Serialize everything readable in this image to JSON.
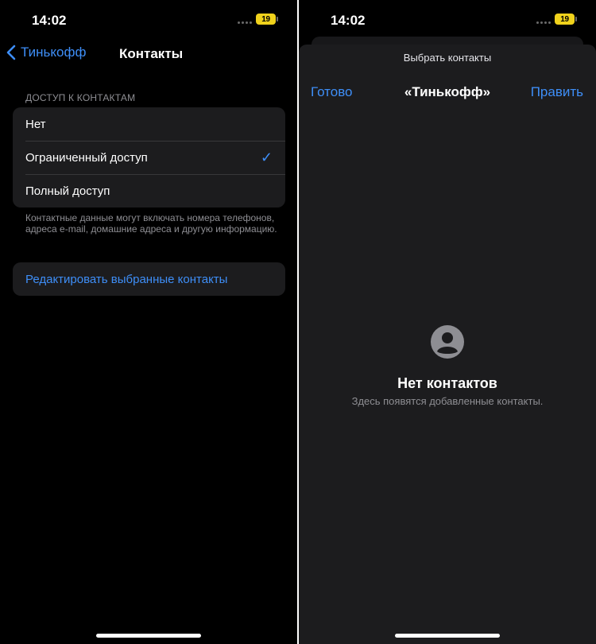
{
  "status_bar": {
    "time": "14:02",
    "battery": "19"
  },
  "left": {
    "nav": {
      "back_label": "Тинькофф",
      "title": "Контакты"
    },
    "section_header": "ДОСТУП К КОНТАКТАМ",
    "options": [
      {
        "label": "Нет",
        "selected": false
      },
      {
        "label": "Ограниченный доступ",
        "selected": true
      },
      {
        "label": "Полный доступ",
        "selected": false
      }
    ],
    "check_glyph": "✓",
    "footer_note": "Контактные данные могут включать номера телефонов, адреса e-mail, домашние адреса и другую информацию.",
    "edit_label": "Редактировать выбранные контакты"
  },
  "right": {
    "caption": "Выбрать контакты",
    "done_label": "Готово",
    "title": "«Тинькофф»",
    "edit_label": "Править",
    "empty_title": "Нет контактов",
    "empty_subtitle": "Здесь появятся добавленные контакты."
  },
  "colors": {
    "accent": "#3e8ef7",
    "background": "#000000",
    "cell": "#1c1c1e",
    "secondary_text": "#8e8e93",
    "battery": "#f0d21c"
  },
  "icons": {
    "back": "chevron-left-icon",
    "check": "checkmark-icon",
    "empty": "person-circle-icon"
  }
}
